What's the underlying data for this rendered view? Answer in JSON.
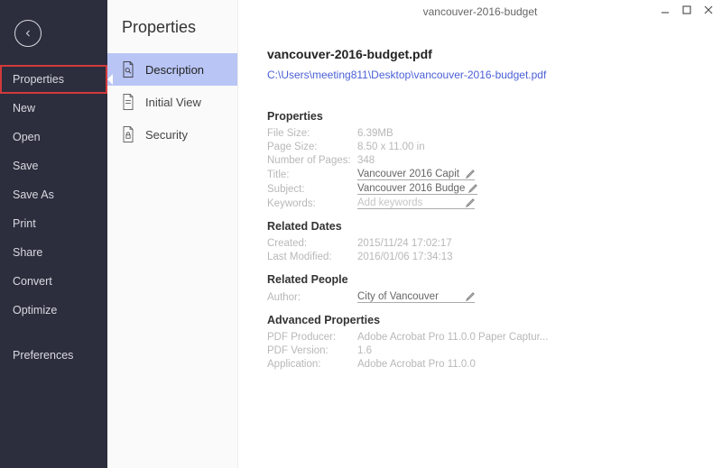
{
  "window": {
    "title": "vancouver-2016-budget"
  },
  "darkSidebar": {
    "items": [
      {
        "label": "Properties",
        "active": true
      },
      {
        "label": "New"
      },
      {
        "label": "Open"
      },
      {
        "label": "Save"
      },
      {
        "label": "Save As"
      },
      {
        "label": "Print"
      },
      {
        "label": "Share"
      },
      {
        "label": "Convert"
      },
      {
        "label": "Optimize"
      }
    ],
    "prefs": "Preferences"
  },
  "lightSidebar": {
    "title": "Properties",
    "items": [
      {
        "label": "Description",
        "selected": true
      },
      {
        "label": "Initial View"
      },
      {
        "label": "Security"
      }
    ]
  },
  "doc": {
    "title": "vancouver-2016-budget.pdf",
    "path": "C:\\Users\\meeting811\\Desktop\\vancouver-2016-budget.pdf"
  },
  "props": {
    "heading": "Properties",
    "fileSizeLabel": "File Size:",
    "fileSize": "6.39MB",
    "pageSizeLabel": "Page Size:",
    "pageSize": "8.50 x 11.00 in",
    "numPagesLabel": "Number of Pages:",
    "numPages": "348",
    "titleLabel": "Title:",
    "titleValue": "Vancouver 2016 Capit",
    "subjectLabel": "Subject:",
    "subjectValue": "Vancouver 2016 Budge",
    "keywordsLabel": "Keywords:",
    "keywordsPlaceholder": "Add keywords"
  },
  "dates": {
    "heading": "Related Dates",
    "createdLabel": "Created:",
    "created": "2015/11/24 17:02:17",
    "modifiedLabel": "Last Modified:",
    "modified": "2016/01/06 17:34:13"
  },
  "people": {
    "heading": "Related People",
    "authorLabel": "Author:",
    "author": "City of Vancouver"
  },
  "advanced": {
    "heading": "Advanced Properties",
    "producerLabel": "PDF Producer:",
    "producer": "Adobe Acrobat Pro 11.0.0 Paper Captur...",
    "versionLabel": "PDF Version:",
    "version": "1.6",
    "appLabel": "Application:",
    "app": "Adobe Acrobat Pro 11.0.0"
  }
}
